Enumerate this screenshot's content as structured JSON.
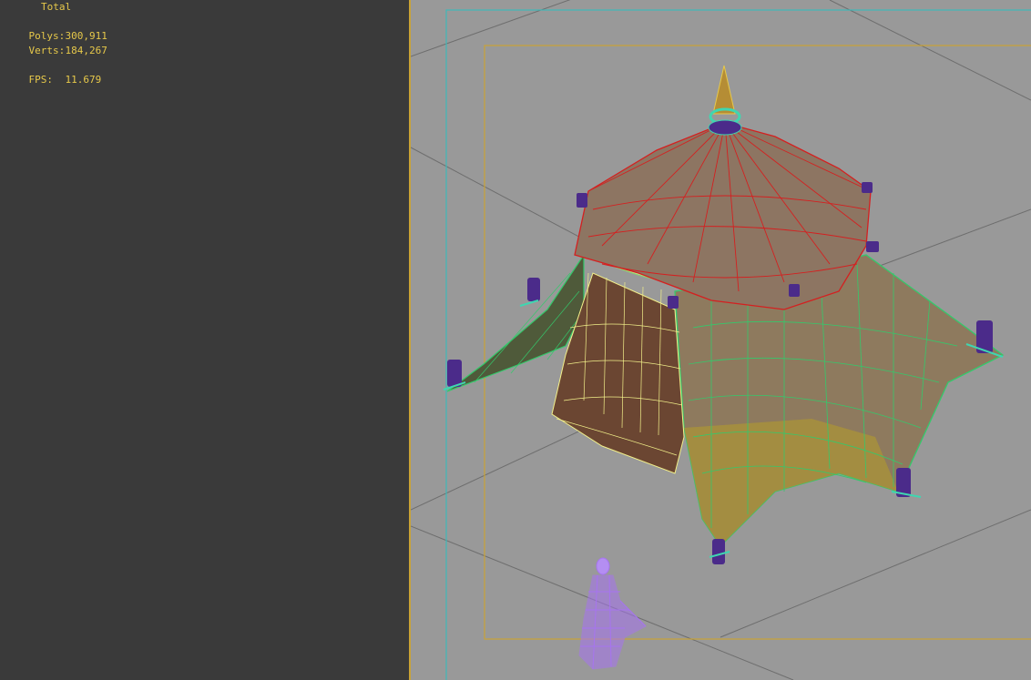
{
  "hud": {
    "header": "Total",
    "polys_label": "Polys:",
    "polys_value": "300,911",
    "verts_label": "Verts:",
    "verts_value": "184,267",
    "fps_label": "FPS:",
    "fps_value": "11.679"
  },
  "colors": {
    "panel_bg": "#3a3a3a",
    "viewport_bg": "#999999",
    "hud_text": "#e6c84a",
    "safe_frame_outer": "#3fb8b8",
    "safe_frame_inner": "#c9a336",
    "wire_red": "#d42020",
    "wire_green": "#34c96b",
    "wire_yellow": "#f2f08a",
    "character_wire": "#a774f0"
  },
  "viewport": {
    "model": "tent-with-character",
    "character_icon": "character-wireframe-icon"
  }
}
